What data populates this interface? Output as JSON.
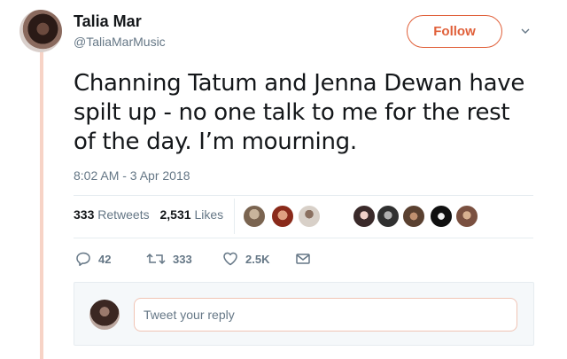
{
  "author": {
    "name": "Talia Mar",
    "handle": "@TaliaMarMusic",
    "follow_label": "Follow"
  },
  "tweet": {
    "text": "Channing Tatum and Jenna Dewan have spilt up - no one talk to me for the rest of the day. I’m mourning.",
    "timestamp": "8:02 AM - 3 Apr 2018"
  },
  "stats": {
    "retweets_count": "333",
    "retweets_label": "Retweets",
    "likes_count": "2,531",
    "likes_label": "Likes"
  },
  "actions": {
    "replies": "42",
    "retweets": "333",
    "likes": "2.5K"
  },
  "reply": {
    "placeholder": "Tweet your reply"
  },
  "colors": {
    "accent": "#e0603a",
    "thread_line": "#f7d3c6",
    "muted_text": "#657786"
  },
  "icons": [
    "reply-icon",
    "retweet-icon",
    "like-icon",
    "message-icon",
    "chevron-down-icon"
  ]
}
